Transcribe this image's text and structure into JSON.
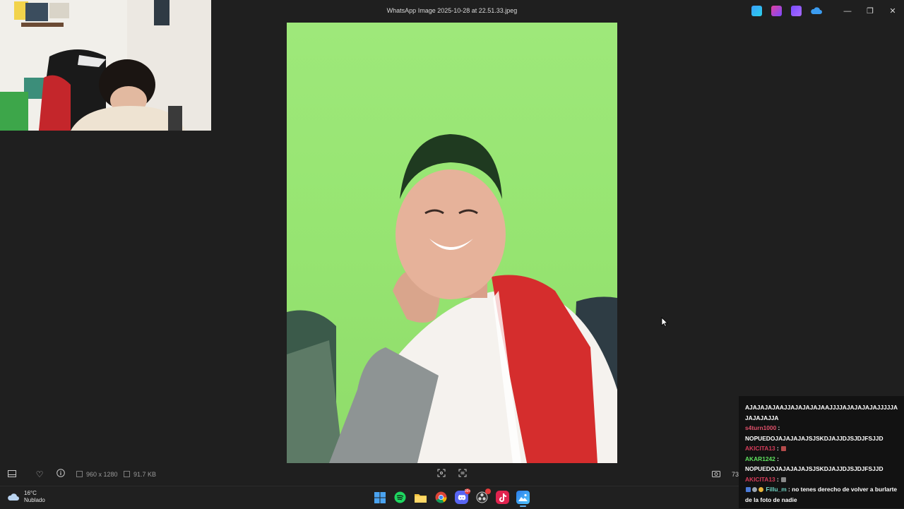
{
  "window": {
    "title": "WhatsApp Image 2025-10-28 at 22.51.33.jpeg",
    "toolbar_icons": [
      "edit-icon",
      "designer-icon",
      "clipchamp-icon",
      "onedrive-icon"
    ],
    "controls": {
      "minimize": "—",
      "maximize": "❐",
      "close": "✕"
    }
  },
  "image_info": {
    "resolution": "960 x 1280",
    "size": "91.7 KB",
    "zoom_partial": "73"
  },
  "bottom_icons": [
    "filmstrip-icon",
    "favorite-icon",
    "info-icon",
    "fit-icon",
    "compare-icon",
    "screenshot-icon"
  ],
  "weather": {
    "temperature": "16°C",
    "condition": "Nublado"
  },
  "taskbar_apps": [
    "start-icon",
    "spotify-icon",
    "file-explorer-icon",
    "chrome-icon",
    "discord-icon",
    "obs-icon",
    "tiktok-icon",
    "photos-icon"
  ],
  "taskbar_badges": {
    "discord": "99+"
  },
  "chat": {
    "messages": [
      {
        "user": "",
        "user_color": "#ffffff",
        "text": "AJAJAJAJAAJJAJAJAJAJAAJJJJAJAJAJAJAJJJJJAJAJAJAJJA"
      },
      {
        "user": "s4turn1000",
        "user_color": "#e0506a",
        "text": "NOPUEDOJAJAJAJAJSJSKDJAJJDJSJDJFSJJD"
      },
      {
        "user": "AKICITA13",
        "user_color": "#d63c5a",
        "text": ""
      },
      {
        "user": "AKAR1242",
        "user_color": "#5ee05e",
        "text": "NOPUEDOJAJAJAJAJSJSKDJAJJDJSJDJFSJJD"
      },
      {
        "user": "AKICITA13",
        "user_color": "#d63c5a",
        "text": ""
      },
      {
        "user": "Fillu_m",
        "user_color": "#6fd4c4",
        "text": "no tenes derecho de volver a burlarte de la foto de nadie"
      }
    ]
  },
  "colors": {
    "background": "#1f1f1f",
    "photo_wall": "#97e572",
    "chat_bg": "#121212",
    "accent": "#5fb2f2"
  }
}
